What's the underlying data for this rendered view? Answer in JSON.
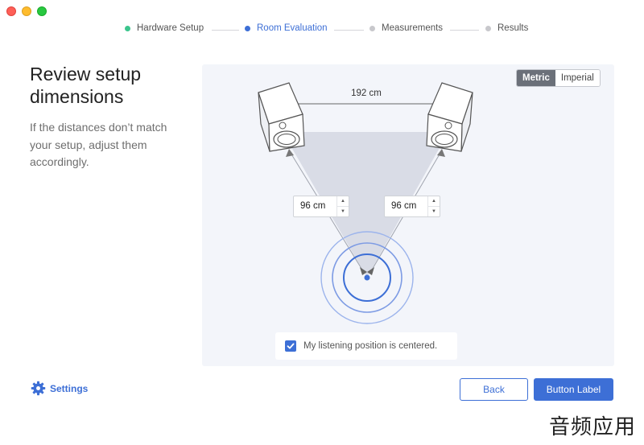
{
  "steps": [
    {
      "label": "Hardware Setup",
      "state": "done"
    },
    {
      "label": "Room Evaluation",
      "state": "active"
    },
    {
      "label": "Measurements",
      "state": "pending"
    },
    {
      "label": "Results",
      "state": "pending"
    }
  ],
  "page": {
    "title": "Review setup dimensions",
    "description": "If the distances don’t match your setup, adjust them accordingly."
  },
  "units": {
    "metric_label": "Metric",
    "imperial_label": "Imperial",
    "selected": "Metric"
  },
  "diagram": {
    "speaker_distance": "192 cm",
    "left_distance": "96 cm",
    "right_distance": "96 cm"
  },
  "centered_checkbox": {
    "label": "My listening position is centered.",
    "checked": true
  },
  "footer": {
    "settings_label": "Settings",
    "back_label": "Back",
    "primary_label": "Button Label"
  },
  "watermark": "音频应用",
  "colors": {
    "accent": "#3d6fd6",
    "done": "#3cc58d",
    "panel_bg": "#f3f5fa"
  }
}
